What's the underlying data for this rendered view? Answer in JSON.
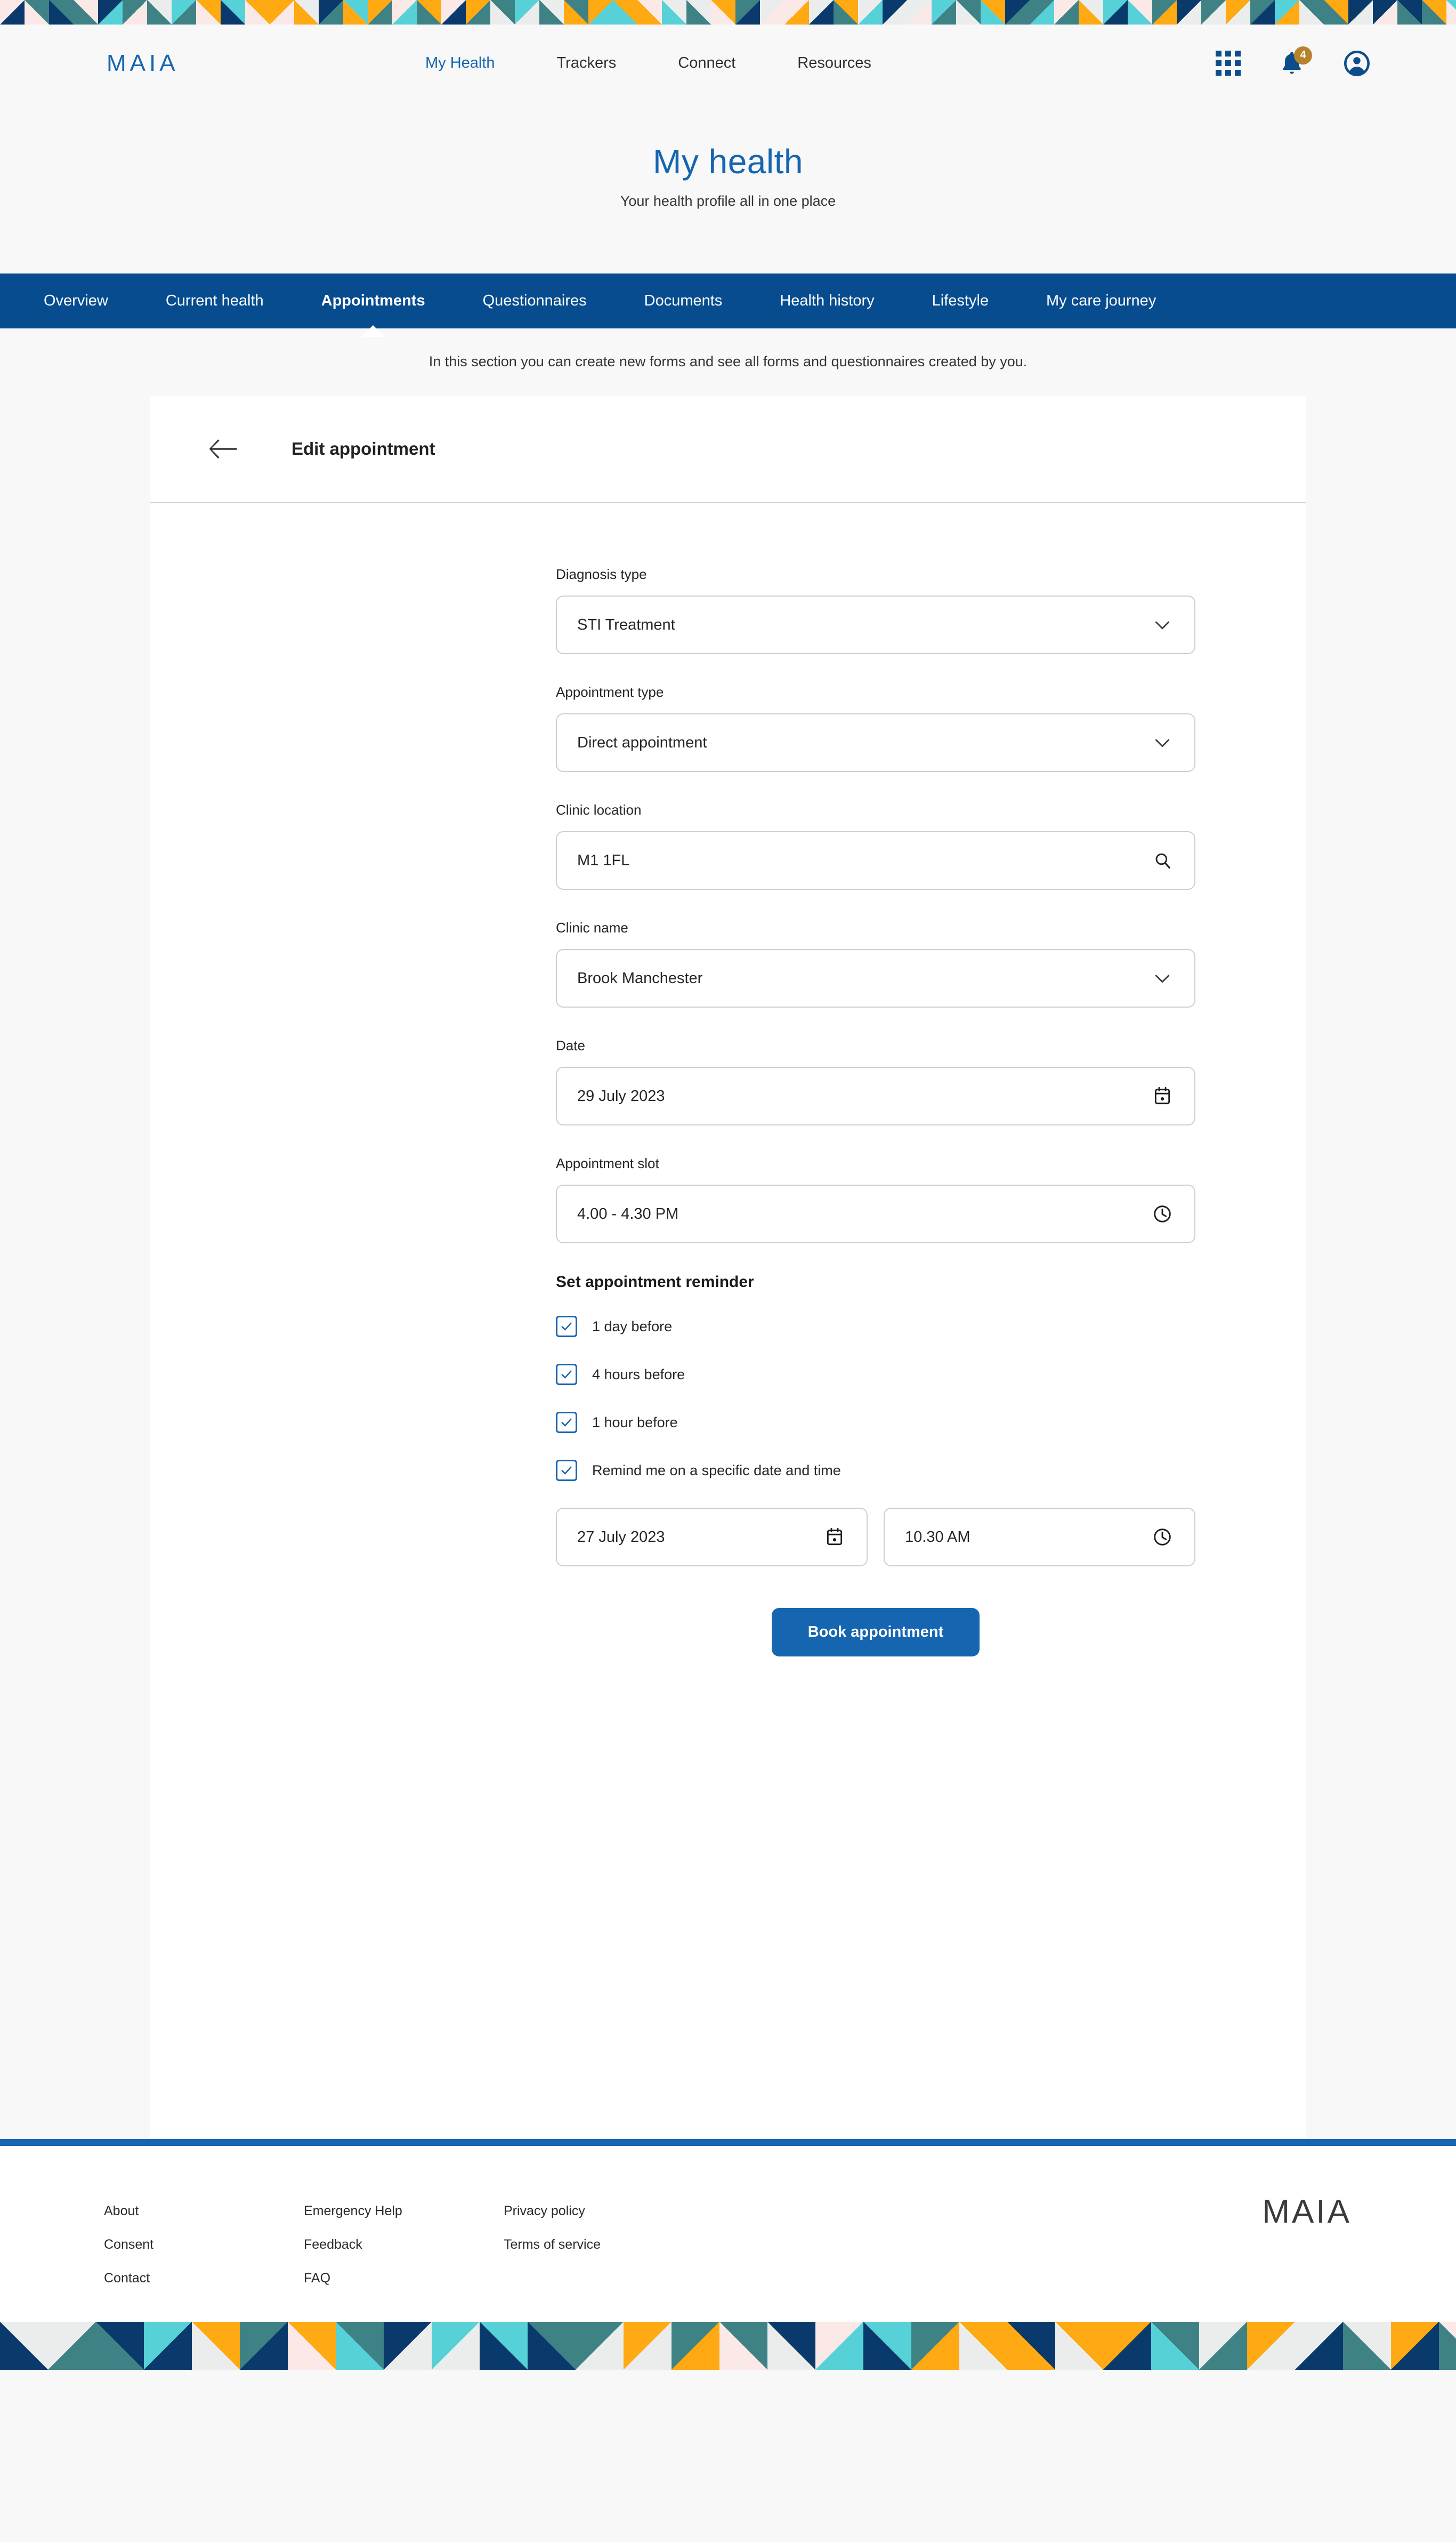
{
  "brand": {
    "name": "MAIA"
  },
  "nav": {
    "items": [
      {
        "label": "My Health",
        "active": true
      },
      {
        "label": "Trackers",
        "active": false
      },
      {
        "label": "Connect",
        "active": false
      },
      {
        "label": "Resources",
        "active": false
      }
    ],
    "icons": {
      "apps": "grid-icon",
      "notifications": "bell-icon",
      "account": "user-avatar-icon"
    },
    "notification_count": "4"
  },
  "hero": {
    "title": "My health",
    "subtitle": "Your health profile all in one place"
  },
  "tabs": [
    {
      "label": "Overview",
      "active": false
    },
    {
      "label": "Current health",
      "active": false
    },
    {
      "label": "Appointments",
      "active": true
    },
    {
      "label": "Questionnaires",
      "active": false
    },
    {
      "label": "Documents",
      "active": false
    },
    {
      "label": "Health history",
      "active": false
    },
    {
      "label": "Lifestyle",
      "active": false
    },
    {
      "label": "My care journey",
      "active": false
    }
  ],
  "section_description": "In this section you can create new forms and see all forms and questionnaires created by you.",
  "card": {
    "title": "Edit appointment",
    "back_icon": "arrow-left-icon"
  },
  "form": {
    "fields": [
      {
        "label": "Diagnosis type",
        "value": "STI Treatment",
        "control": "select",
        "icon": "chevron-down-icon"
      },
      {
        "label": "Appointment type",
        "value": "Direct appointment",
        "control": "select",
        "icon": "chevron-down-icon"
      },
      {
        "label": "Clinic location",
        "value": "M1 1FL",
        "control": "search",
        "icon": "search-icon"
      },
      {
        "label": "Clinic name",
        "value": "Brook Manchester",
        "control": "select",
        "icon": "chevron-down-icon"
      },
      {
        "label": "Date",
        "value": "29 July 2023",
        "control": "date",
        "icon": "calendar-icon"
      },
      {
        "label": "Appointment slot",
        "value": "4.00 - 4.30 PM",
        "control": "time",
        "icon": "clock-icon"
      }
    ],
    "reminder": {
      "title": "Set appointment reminder",
      "options": [
        {
          "label": "1 day before",
          "checked": true
        },
        {
          "label": "4 hours before",
          "checked": true
        },
        {
          "label": "1 hour before",
          "checked": true
        },
        {
          "label": "Remind me on a specific date and time",
          "checked": true
        }
      ],
      "specific_date": {
        "value": "27 July 2023",
        "icon": "calendar-icon"
      },
      "specific_time": {
        "value": "10.30 AM",
        "icon": "clock-icon"
      }
    },
    "submit_label": "Book appointment"
  },
  "footer": {
    "columns": [
      [
        "About",
        "Consent",
        "Contact"
      ],
      [
        "Emergency Help",
        "Feedback",
        "FAQ"
      ],
      [
        "Privacy policy",
        "Terms of service"
      ]
    ],
    "logo": "MAIA"
  },
  "colors": {
    "brand_blue": "#1565b0",
    "nav_blue": "#064c8e",
    "badge_gold": "#b8832d",
    "pattern_teal": "#3e8285",
    "pattern_turquoise": "#57d1d8",
    "pattern_orange": "#ffa913",
    "pattern_navy": "#0a3a6b",
    "pattern_cream": "#fae9e7",
    "pattern_grey": "#ebedec",
    "page_bg": "#f8f8f8"
  }
}
